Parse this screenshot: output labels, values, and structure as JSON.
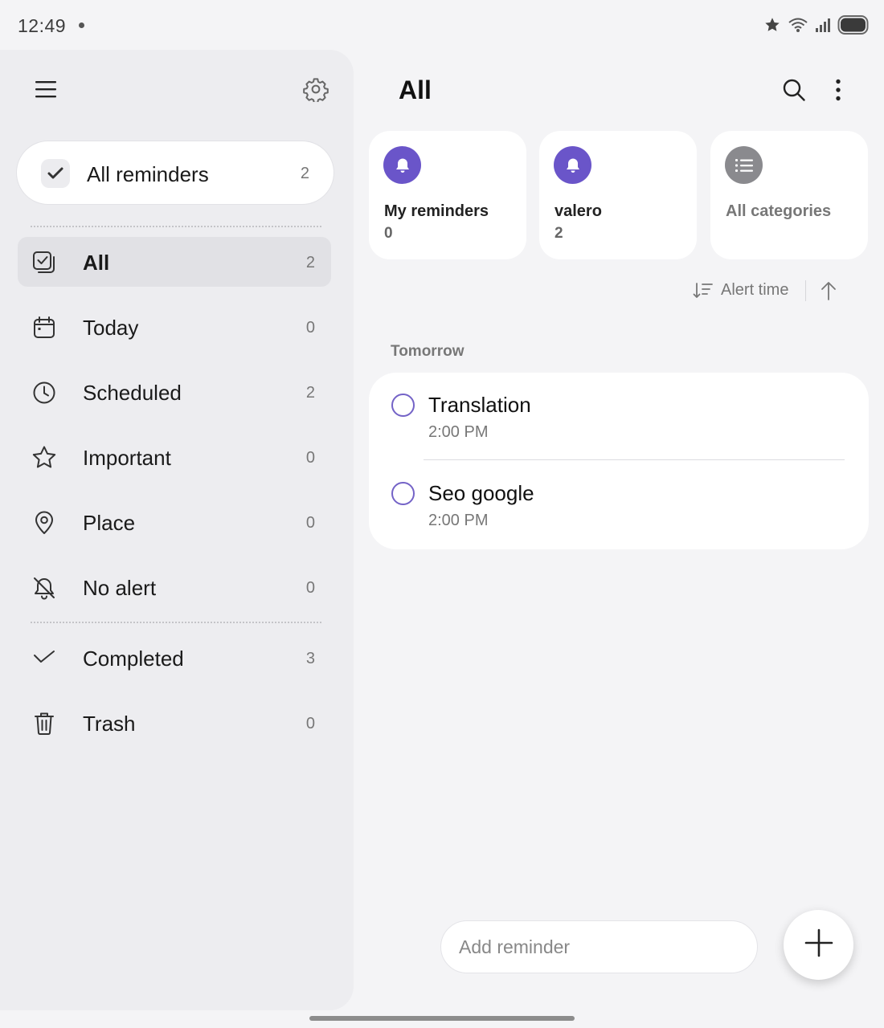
{
  "status_bar": {
    "time": "12:49"
  },
  "sidebar": {
    "all_reminders": {
      "label": "All reminders",
      "count": "2"
    },
    "items": [
      {
        "label": "All",
        "count": "2",
        "icon": "all-tasks-icon",
        "selected": true
      },
      {
        "label": "Today",
        "count": "0",
        "icon": "calendar-icon"
      },
      {
        "label": "Scheduled",
        "count": "2",
        "icon": "clock-icon"
      },
      {
        "label": "Important",
        "count": "0",
        "icon": "star-icon"
      },
      {
        "label": "Place",
        "count": "0",
        "icon": "location-pin-icon"
      },
      {
        "label": "No alert",
        "count": "0",
        "icon": "bell-off-icon"
      }
    ],
    "secondary_items": [
      {
        "label": "Completed",
        "count": "3",
        "icon": "checkmark-icon"
      },
      {
        "label": "Trash",
        "count": "0",
        "icon": "trash-icon"
      }
    ]
  },
  "main": {
    "title": "All",
    "categories": [
      {
        "name": "My reminders",
        "count": "0",
        "icon": "bell-icon",
        "color": "#6a55c9"
      },
      {
        "name": "valero",
        "count": "2",
        "icon": "bell-icon",
        "color": "#6a55c9"
      },
      {
        "name": "All categories",
        "icon": "list-icon",
        "color": "#8a8a8e"
      }
    ],
    "sort": {
      "label": "Alert time",
      "direction": "ascending"
    },
    "section": "Tomorrow",
    "reminders": [
      {
        "title": "Translation",
        "time": "2:00 PM"
      },
      {
        "title": "Seo google",
        "time": "2:00 PM"
      }
    ],
    "add_placeholder": "Add reminder"
  },
  "colors": {
    "accent": "#6a55c9",
    "background": "#f4f4f6",
    "sidebar": "#ededf0"
  }
}
